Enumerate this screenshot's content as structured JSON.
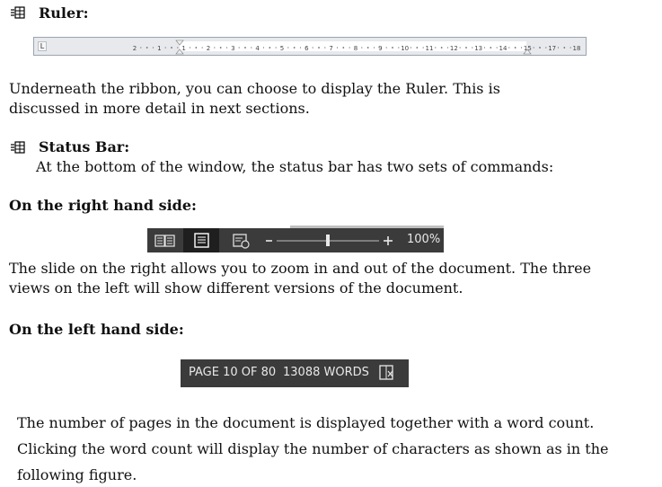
{
  "ruler_section": {
    "title": "Ruler:"
  },
  "ruler_labels": [
    "2",
    "1",
    "1",
    "2",
    "3",
    "4",
    "5",
    "6",
    "7",
    "8",
    "9",
    "10",
    "11",
    "12",
    "13",
    "14",
    "15",
    "17",
    "18"
  ],
  "para1": {
    "line1": "Underneath the ribbon, you can choose to display the Ruler. This is",
    "line2": "discussed in more detail in next sections."
  },
  "status_section": {
    "title": "Status Bar:",
    "text": "At the bottom of the window, the status bar has two sets of commands:"
  },
  "right_side": {
    "heading": "On the right hand side:",
    "zoom_label": "100%",
    "zoom_level": 0.5
  },
  "para2": {
    "line1": "The slide on the right allows you to zoom in and out of the document. The three",
    "line2": "views on the left will show different versions of the document."
  },
  "left_side": {
    "heading": "On the left hand side:",
    "page_info": "PAGE 10 OF 80",
    "word_count": "13088 WORDS"
  },
  "para3": {
    "line1": "The number of pages in the document is displayed together with a word count.",
    "line2": "Clicking the word count will display the number of characters as shown as in the",
    "line3": "following figure."
  },
  "colors": {
    "status_bar": "#3b3b3b",
    "status_active": "#1f1f1f",
    "status_text": "#e8e8e8"
  },
  "icons": [
    "bullet-icon",
    "read-mode-icon",
    "print-layout-icon",
    "web-layout-icon",
    "proofing-icon"
  ]
}
